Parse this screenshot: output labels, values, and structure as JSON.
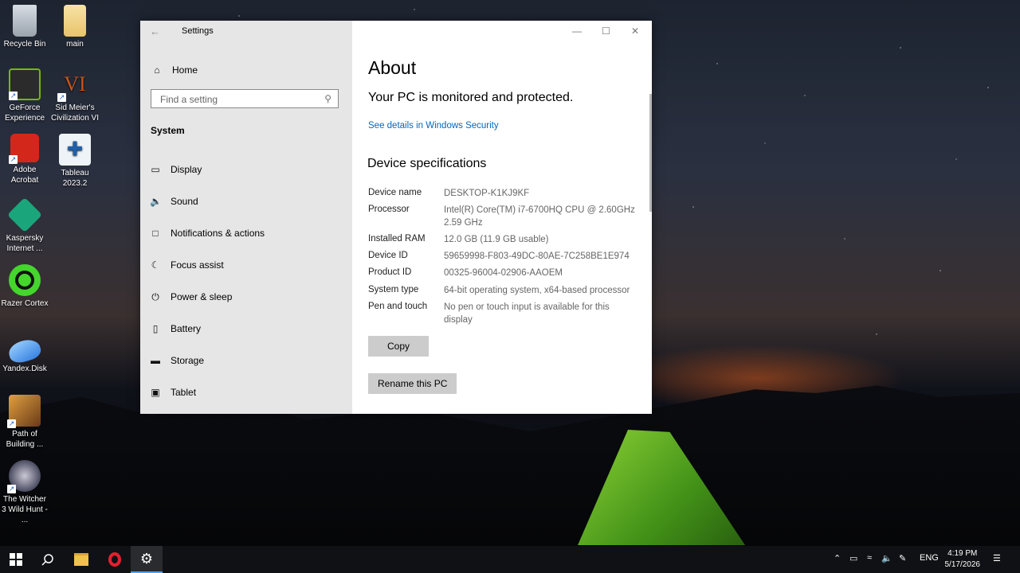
{
  "desktop": {
    "icons": [
      {
        "label": "Recycle Bin",
        "icon": "recycle-bin-icon"
      },
      {
        "label": "main",
        "icon": "folder-icon"
      },
      {
        "label": "GeForce Experience",
        "icon": "geforce-icon"
      },
      {
        "label": "Sid Meier's Civilization VI",
        "icon": "civilization-icon"
      },
      {
        "label": "Adobe Acrobat",
        "icon": "acrobat-icon"
      },
      {
        "label": "Tableau 2023.2",
        "icon": "tableau-icon"
      },
      {
        "label": "Kaspersky Internet ...",
        "icon": "kaspersky-icon"
      },
      {
        "label": "Razer Cortex",
        "icon": "razer-cortex-icon"
      },
      {
        "label": "Yandex.Disk",
        "icon": "yandex-disk-icon"
      },
      {
        "label": "Path of Building ...",
        "icon": "path-of-building-icon"
      },
      {
        "label": "The Witcher 3 Wild Hunt - ...",
        "icon": "witcher-icon"
      }
    ]
  },
  "window": {
    "title": "Settings",
    "sidebar": {
      "home_label": "Home",
      "search_placeholder": "Find a setting",
      "section": "System",
      "items": [
        {
          "label": "Display",
          "icon": "monitor-icon"
        },
        {
          "label": "Sound",
          "icon": "speaker-icon"
        },
        {
          "label": "Notifications & actions",
          "icon": "notifications-icon"
        },
        {
          "label": "Focus assist",
          "icon": "moon-icon"
        },
        {
          "label": "Power & sleep",
          "icon": "power-icon"
        },
        {
          "label": "Battery",
          "icon": "battery-icon"
        },
        {
          "label": "Storage",
          "icon": "storage-icon"
        },
        {
          "label": "Tablet",
          "icon": "tablet-icon"
        }
      ]
    },
    "content": {
      "heading": "About",
      "protection_status": "Your PC is monitored and protected.",
      "security_link": "See details in Windows Security",
      "specs_heading": "Device specifications",
      "specs": [
        {
          "label": "Device name",
          "value": "DESKTOP-K1KJ9KF"
        },
        {
          "label": "Processor",
          "value": "Intel(R) Core(TM) i7-6700HQ CPU @ 2.60GHz 2.59 GHz"
        },
        {
          "label": "Installed RAM",
          "value": "12.0 GB (11.9 GB usable)"
        },
        {
          "label": "Device ID",
          "value": "59659998-F803-49DC-80AE-7C258BE1E974"
        },
        {
          "label": "Product ID",
          "value": "00325-96004-02906-AAOEM"
        },
        {
          "label": "System type",
          "value": "64-bit operating system, x64-based processor"
        },
        {
          "label": "Pen and touch",
          "value": "No pen or touch input is available for this display"
        }
      ],
      "copy_button": "Copy",
      "rename_button": "Rename this PC"
    }
  },
  "taskbar": {
    "language": "ENG",
    "time": "4:19 PM",
    "date": "5/17/2026"
  },
  "colors": {
    "link": "#0067c0",
    "sidebar_bg": "#e6e6e6",
    "button_bg": "#cccccc",
    "taskbar_bg": "#101114"
  }
}
